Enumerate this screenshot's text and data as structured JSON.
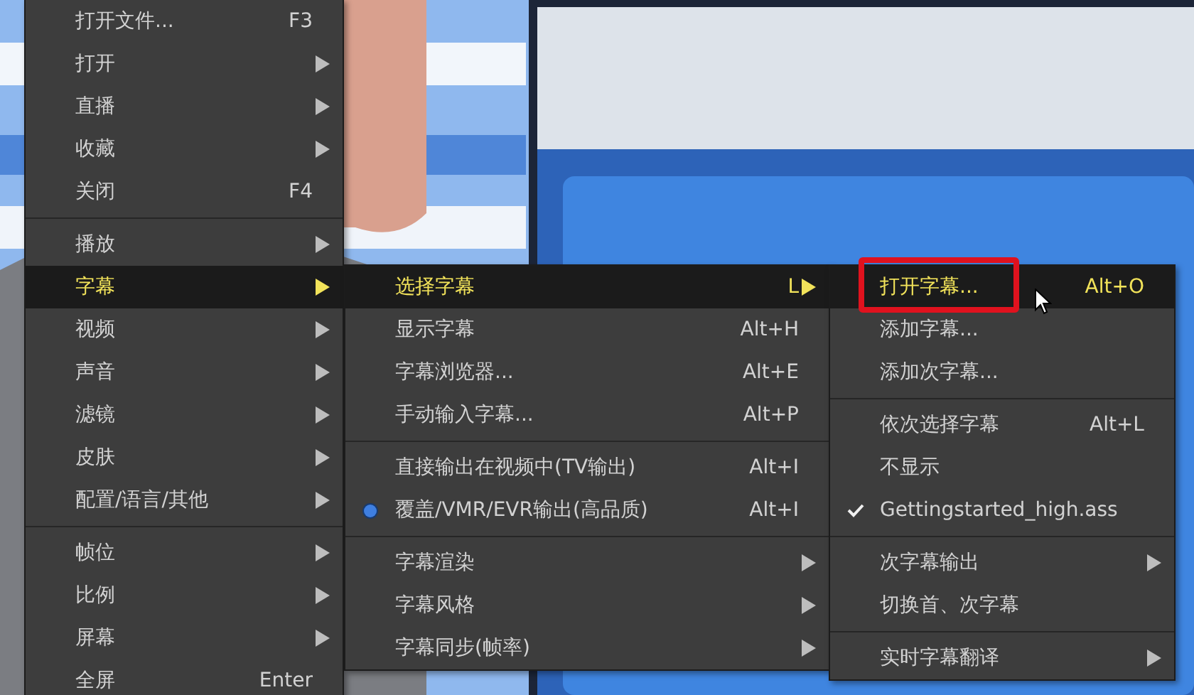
{
  "menus": [
    {
      "items": [
        {
          "kind": "command",
          "label": "打开文件...",
          "shortcut": "F3",
          "submenu": false,
          "selected": false
        },
        {
          "kind": "command",
          "label": "打开",
          "submenu": true,
          "selected": false
        },
        {
          "kind": "command",
          "label": "直播",
          "submenu": true,
          "selected": false
        },
        {
          "kind": "command",
          "label": "收藏",
          "submenu": true,
          "selected": false
        },
        {
          "kind": "command",
          "label": "关闭",
          "shortcut": "F4",
          "submenu": false,
          "selected": false
        },
        {
          "kind": "separator"
        },
        {
          "kind": "command",
          "label": "播放",
          "submenu": true,
          "selected": false
        },
        {
          "kind": "command",
          "label": "字幕",
          "submenu": true,
          "selected": true
        },
        {
          "kind": "command",
          "label": "视频",
          "submenu": true,
          "selected": false
        },
        {
          "kind": "command",
          "label": "声音",
          "submenu": true,
          "selected": false
        },
        {
          "kind": "command",
          "label": "滤镜",
          "submenu": true,
          "selected": false
        },
        {
          "kind": "command",
          "label": "皮肤",
          "submenu": true,
          "selected": false
        },
        {
          "kind": "command",
          "label": "配置/语言/其他",
          "submenu": true,
          "selected": false
        },
        {
          "kind": "separator"
        },
        {
          "kind": "command",
          "label": "帧位",
          "submenu": true,
          "selected": false
        },
        {
          "kind": "command",
          "label": "比例",
          "submenu": true,
          "selected": false
        },
        {
          "kind": "command",
          "label": "屏幕",
          "submenu": true,
          "selected": false
        },
        {
          "kind": "command",
          "label": "全屏",
          "shortcut": "Enter",
          "submenu": false,
          "selected": false
        }
      ]
    },
    {
      "items": [
        {
          "kind": "command",
          "label": "选择字幕",
          "shortcut": "L",
          "submenu": true,
          "selected": true
        },
        {
          "kind": "command",
          "label": "显示字幕",
          "shortcut": "Alt+H",
          "submenu": false,
          "selected": false
        },
        {
          "kind": "command",
          "label": "字幕浏览器...",
          "shortcut": "Alt+E",
          "submenu": false,
          "selected": false
        },
        {
          "kind": "command",
          "label": "手动输入字幕...",
          "shortcut": "Alt+P",
          "submenu": false,
          "selected": false
        },
        {
          "kind": "separator"
        },
        {
          "kind": "radio",
          "label": "直接输出在视频中(TV输出)",
          "shortcut": "Alt+I",
          "submenu": false,
          "selected": false,
          "checked": false
        },
        {
          "kind": "radio",
          "label": "覆盖/VMR/EVR输出(高品质)",
          "shortcut": "Alt+I",
          "submenu": false,
          "selected": false,
          "checked": true
        },
        {
          "kind": "separator"
        },
        {
          "kind": "command",
          "label": "字幕渲染",
          "submenu": true,
          "selected": false
        },
        {
          "kind": "command",
          "label": "字幕风格",
          "submenu": true,
          "selected": false
        },
        {
          "kind": "command",
          "label": "字幕同步(帧率)",
          "submenu": true,
          "selected": false
        }
      ]
    },
    {
      "items": [
        {
          "kind": "command",
          "label": "打开字幕...",
          "shortcut": "Alt+O",
          "submenu": false,
          "selected": true,
          "highlighted": true
        },
        {
          "kind": "command",
          "label": "添加字幕...",
          "submenu": false,
          "selected": false
        },
        {
          "kind": "command",
          "label": "添加次字幕...",
          "submenu": false,
          "selected": false
        },
        {
          "kind": "separator"
        },
        {
          "kind": "command",
          "label": "依次选择字幕",
          "shortcut": "Alt+L",
          "submenu": false,
          "selected": false
        },
        {
          "kind": "check",
          "label": "不显示",
          "submenu": false,
          "selected": false,
          "checked": false
        },
        {
          "kind": "check",
          "label": "Gettingstarted_high.ass",
          "submenu": false,
          "selected": false,
          "checked": true
        },
        {
          "kind": "separator"
        },
        {
          "kind": "command",
          "label": "次字幕输出",
          "submenu": true,
          "selected": false
        },
        {
          "kind": "command",
          "label": "切换首、次字幕",
          "submenu": false,
          "selected": false
        },
        {
          "kind": "separator"
        },
        {
          "kind": "command",
          "label": "实时字幕翻译",
          "submenu": true,
          "selected": false
        }
      ]
    }
  ]
}
